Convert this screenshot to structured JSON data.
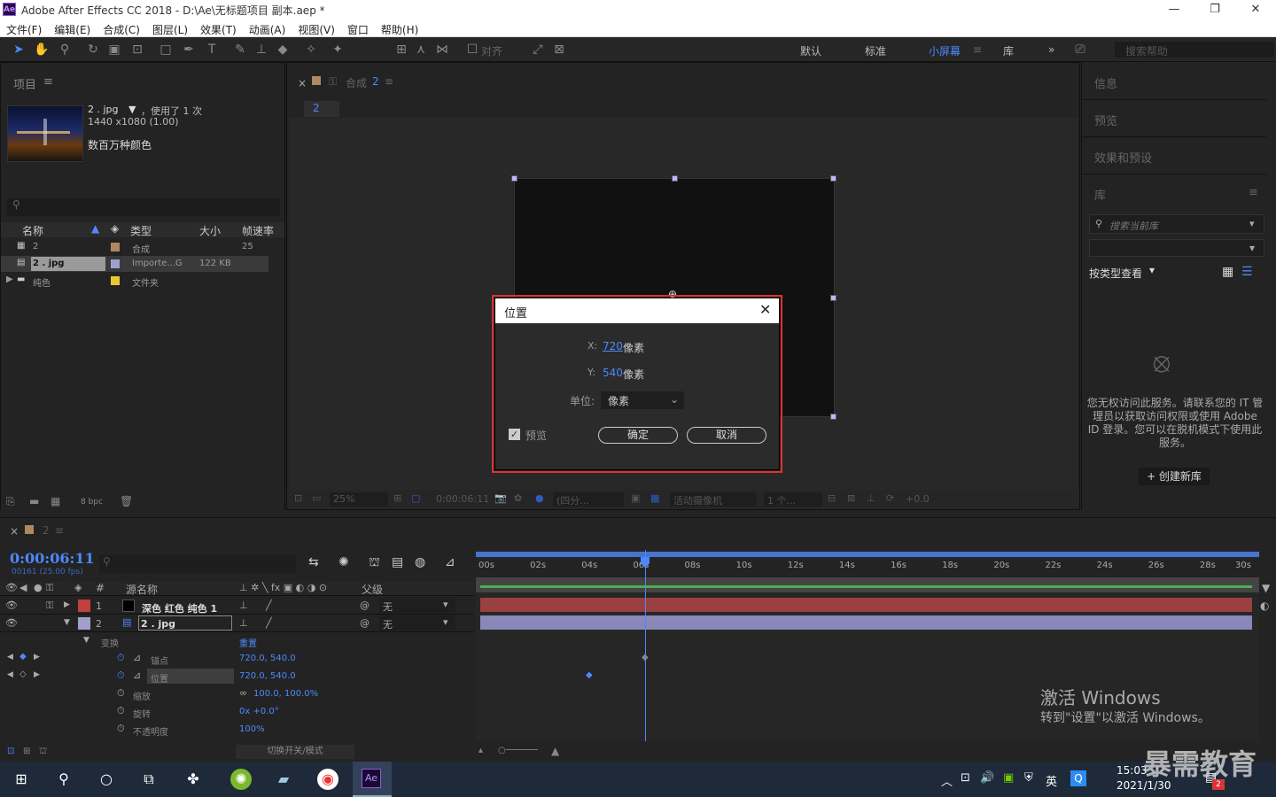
{
  "window": {
    "title": "Adobe After Effects CC 2018 - D:\\Ae\\无标题项目 副本.aep *",
    "logo": "Ae",
    "minimize": "—",
    "restore": "❐",
    "close": "✕"
  },
  "menu": [
    "文件(F)",
    "编辑(E)",
    "合成(C)",
    "图层(L)",
    "效果(T)",
    "动画(A)",
    "视图(V)",
    "窗口",
    "帮助(H)"
  ],
  "toolbar": {
    "align_label": "对齐",
    "workspaces": [
      "默认",
      "标准",
      "小屏幕",
      "库"
    ],
    "active_workspace": "小屏幕",
    "search_placeholder": "搜索帮助"
  },
  "project": {
    "title": "项目",
    "item_name": "2 . jpg",
    "item_usage": "，使用了 1 次",
    "item_dims": "1440 x1080 (1.00)",
    "item_colors": "数百万种颜色",
    "columns": [
      "名称",
      "类型",
      "大小",
      "帧速率"
    ],
    "rows": [
      {
        "name": "2",
        "type": "合成",
        "size": "",
        "fps": "25",
        "color": "#b08860"
      },
      {
        "name": "2 . jpg",
        "type": "Importe...G",
        "size": "122 KB",
        "fps": "",
        "color": "#a0a0d0"
      },
      {
        "name": "纯色",
        "type": "文件夹",
        "size": "",
        "fps": "",
        "color": "#e8c830"
      }
    ],
    "bpc": "8 bpc"
  },
  "comp": {
    "tab_label": "合成",
    "tab_name": "2",
    "breadcrumb": "2",
    "footer_zoom": "25%",
    "footer_time": "0:00:06:11",
    "footer_res": "(四分...",
    "footer_camera": "活动摄像机",
    "footer_views": "1 个...",
    "footer_exposure": "+0.0"
  },
  "right": {
    "panels": [
      "信息",
      "预览",
      "效果和预设",
      "库"
    ],
    "lib_search_placeholder": "搜索当前库",
    "view_by": "按类型查看",
    "message": "您无权访问此服务。请联系您的 IT 管理员以获取访问权限或使用 Adobe ID 登录。您可以在脱机模式下使用此服务。",
    "create_btn": "+ 创建新库"
  },
  "timeline": {
    "tab": "2",
    "timecode": "0:00:06:11",
    "timecode_sub": "00161 (25.00 fps)",
    "header": {
      "num": "#",
      "name": "源名称",
      "parent": "父级"
    },
    "ticks": [
      "00s",
      "02s",
      "04s",
      "06s",
      "08s",
      "10s",
      "12s",
      "14s",
      "16s",
      "18s",
      "20s",
      "22s",
      "24s",
      "26s",
      "28s",
      "30s"
    ],
    "layers": [
      {
        "num": "1",
        "name": "深色 红色 纯色 1",
        "parent": "无",
        "color": "#c04040"
      },
      {
        "num": "2",
        "name": "2 . jpg",
        "parent": "无",
        "color": "#a0a0c8"
      }
    ],
    "transform": "变换",
    "reset": "重置",
    "props": [
      {
        "name": "锚点",
        "value": "720.0, 540.0"
      },
      {
        "name": "位置",
        "value": "720.0, 540.0"
      },
      {
        "name": "缩放",
        "value": "100.0, 100.0%"
      },
      {
        "name": "旋转",
        "value": "0x +0.0°"
      },
      {
        "name": "不透明度",
        "value": "100%"
      }
    ],
    "footer_toggle": "切换开关/模式"
  },
  "dialog": {
    "title": "位置",
    "x_label": "X:",
    "x_value": "720",
    "x_unit": "像素",
    "y_label": "Y:",
    "y_value": "540",
    "y_unit": "像素",
    "unit_label": "单位:",
    "unit_value": "像素",
    "preview_label": "预览",
    "ok": "确定",
    "cancel": "取消"
  },
  "watermark": {
    "line1": "激活 Windows",
    "line2": "转到\"设置\"以激活 Windows。"
  },
  "taskbar": {
    "time": "15:03",
    "date": "2021/1/30",
    "ime": "英",
    "badge": "2",
    "brand": "暴需教育"
  }
}
